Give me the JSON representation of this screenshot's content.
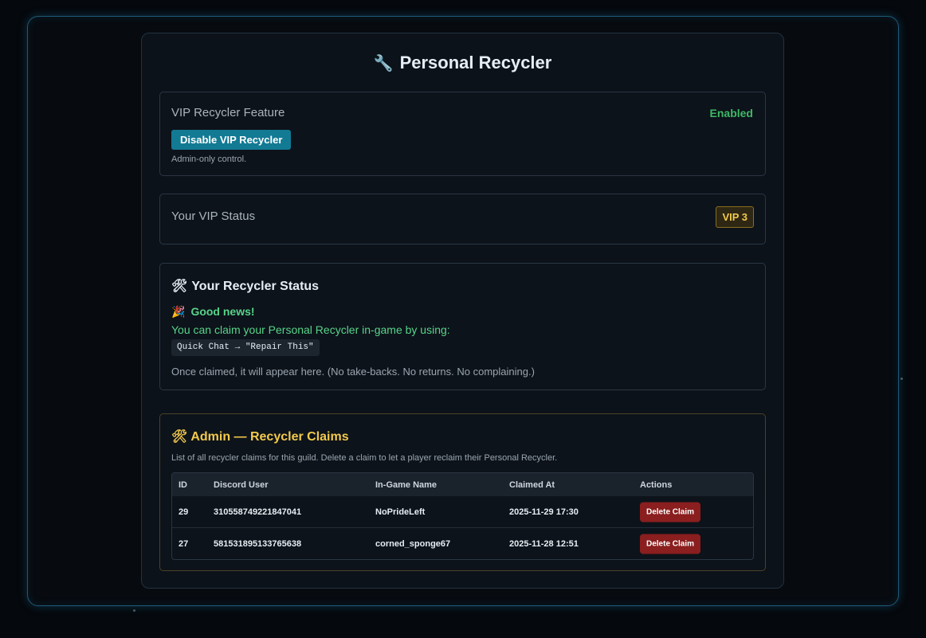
{
  "page": {
    "title": "Personal Recycler",
    "title_icon": "wrench-icon"
  },
  "vip_feature": {
    "label": "VIP Recycler Feature",
    "status": "Enabled",
    "status_color": "#3fb866",
    "button_label": "Disable VIP Recycler",
    "note": "Admin-only control."
  },
  "vip_status": {
    "label": "Your VIP Status",
    "badge": "VIP 3"
  },
  "recycler_status": {
    "title": "Your Recycler Status",
    "title_icon": "hammer-wrench-icon",
    "good_news": "Good news!",
    "good_news_icon": "party-popper-icon",
    "claim_text": "You can claim your Personal Recycler in-game by using:",
    "command": "Quick Chat → \"Repair This\"",
    "footnote": "Once claimed, it will appear here. (No take-backs. No returns. No complaining.)"
  },
  "admin": {
    "title": "Admin — Recycler Claims",
    "title_icon": "hammer-wrench-icon",
    "description": "List of all recycler claims for this guild. Delete a claim to let a player reclaim their Personal Recycler.",
    "columns": [
      "ID",
      "Discord User",
      "In-Game Name",
      "Claimed At",
      "Actions"
    ],
    "rows": [
      {
        "id": "29",
        "discord_user": "310558749221847041",
        "ingame_name": "NoPrideLeft",
        "claimed_at": "2025-11-29 17:30",
        "action": "Delete Claim"
      },
      {
        "id": "27",
        "discord_user": "581531895133765638",
        "ingame_name": "corned_sponge67",
        "claimed_at": "2025-11-28 12:51",
        "action": "Delete Claim"
      }
    ]
  },
  "colors": {
    "accent": "#137a94",
    "danger": "#8b1e1e",
    "gold": "#f2c94c",
    "success": "#57d48a"
  }
}
